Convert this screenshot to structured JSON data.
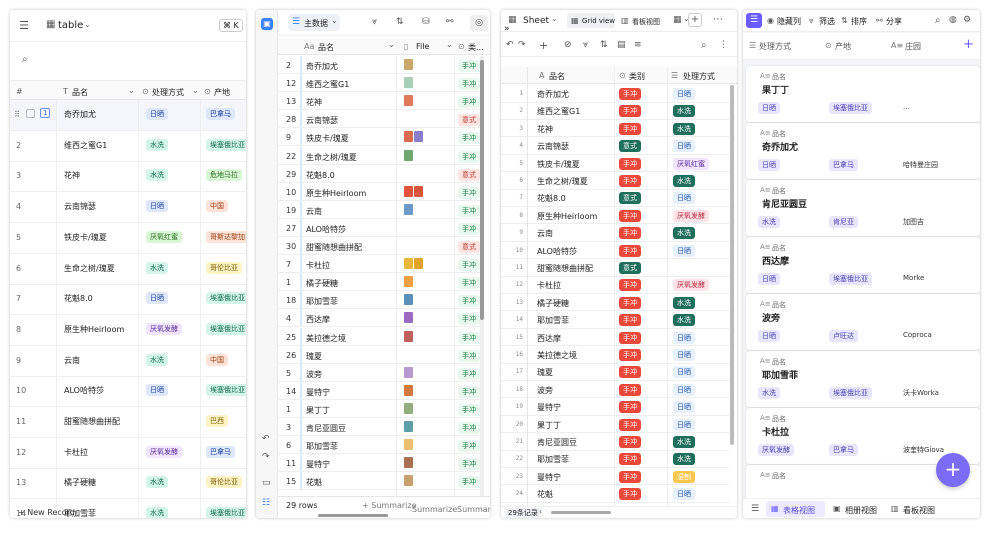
{
  "p1": {
    "title": "table",
    "shortcut": "⌘ K",
    "col_num": "#",
    "col_name": "品名",
    "col_proc": "处理方式",
    "col_origin": "产地",
    "new_record": "New Record",
    "rows": [
      {
        "n": "1",
        "name": "奇乔加尤",
        "proc": "日晒",
        "pc": "t-sun",
        "origin": "巴拿马",
        "oc": "t-sun"
      },
      {
        "n": "2",
        "name": "维西之蜜G1",
        "proc": "水洗",
        "pc": "t-wash",
        "origin": "埃塞俄比亚",
        "oc": "t-wash"
      },
      {
        "n": "3",
        "name": "花神",
        "proc": "水洗",
        "pc": "t-wash",
        "origin": "危地马拉",
        "oc": "t-anaer"
      },
      {
        "n": "4",
        "name": "云南锦瑟",
        "proc": "日晒",
        "pc": "t-sun",
        "origin": "中国",
        "oc": "t-honey"
      },
      {
        "n": "5",
        "name": "铁皮卡/瑰夏",
        "proc": "厌氧红蜜",
        "pc": "t-anaer",
        "origin": "哥斯达黎加",
        "oc": "t-honey"
      },
      {
        "n": "6",
        "name": "生命之树/瑰夏",
        "proc": "水洗",
        "pc": "t-wash",
        "origin": "哥伦比亚",
        "oc": "t-brazil"
      },
      {
        "n": "7",
        "name": "花魁8.0",
        "proc": "日晒",
        "pc": "t-sun",
        "origin": "埃塞俄比亚",
        "oc": "t-wash"
      },
      {
        "n": "8",
        "name": "原生种Heirloom",
        "proc": "厌氧发酵",
        "pc": "t-mix",
        "origin": "埃塞俄比亚",
        "oc": "t-wash"
      },
      {
        "n": "9",
        "name": "云南",
        "proc": "水洗",
        "pc": "t-wash",
        "origin": "中国",
        "oc": "t-honey"
      },
      {
        "n": "10",
        "name": "ALO哈特莎",
        "proc": "日晒",
        "pc": "t-sun",
        "origin": "埃塞俄比亚",
        "oc": "t-wash"
      },
      {
        "n": "11",
        "name": "甜蜜随想曲拼配",
        "proc": "",
        "pc": "",
        "origin": "巴西",
        "oc": "t-brazil"
      },
      {
        "n": "12",
        "name": "卡杜拉",
        "proc": "厌氧发酵",
        "pc": "t-mix",
        "origin": "巴拿马",
        "oc": "t-sun"
      },
      {
        "n": "13",
        "name": "橘子硬糖",
        "proc": "水洗",
        "pc": "t-wash",
        "origin": "哥伦比亚",
        "oc": "t-brazil"
      },
      {
        "n": "14",
        "name": "耶加雪菲",
        "proc": "水洗",
        "pc": "t-wash",
        "origin": "埃塞俄比亚",
        "oc": "t-wash"
      }
    ]
  },
  "p2": {
    "view": "主数据",
    "col_name": "品名",
    "col_file": "File",
    "col_type": "类...",
    "footer_rows": "29 rows",
    "summarize": "Summarize",
    "summarize2": "Summarize",
    "summarize3": "Summariz",
    "rows": [
      {
        "id": "2",
        "name": "奇乔加尤",
        "g": "手冲",
        "gc": "g-hand",
        "th": [
          "#c9a86a"
        ]
      },
      {
        "id": "12",
        "name": "维西之蜜G1",
        "g": "手冲",
        "gc": "g-hand",
        "th": [
          "#a8d0b8"
        ]
      },
      {
        "id": "13",
        "name": "花神",
        "g": "手冲",
        "gc": "g-hand",
        "th": [
          "#e07a5a"
        ]
      },
      {
        "id": "28",
        "name": "云南锦瑟",
        "g": "意式",
        "gc": "g-ice",
        "th": []
      },
      {
        "id": "9",
        "name": "铁皮卡/瑰夏",
        "g": "手冲",
        "gc": "g-hand",
        "th": [
          "#d96b4f",
          "#8a7dc9"
        ]
      },
      {
        "id": "22",
        "name": "生命之树/瑰夏",
        "g": "手冲",
        "gc": "g-hand",
        "th": [
          "#6ea86e"
        ]
      },
      {
        "id": "29",
        "name": "花魁8.0",
        "g": "意式",
        "gc": "g-ice",
        "th": []
      },
      {
        "id": "10",
        "name": "原生种Heirloom",
        "g": "手冲",
        "gc": "g-hand",
        "th": [
          "#e2543e",
          "#d8553a"
        ]
      },
      {
        "id": "19",
        "name": "云南",
        "g": "手冲",
        "gc": "g-hand",
        "th": [
          "#6b9ac8"
        ]
      },
      {
        "id": "27",
        "name": "ALO哈特莎",
        "g": "手冲",
        "gc": "g-hand",
        "th": []
      },
      {
        "id": "30",
        "name": "甜蜜随想曲拼配",
        "g": "意式",
        "gc": "g-ice",
        "th": []
      },
      {
        "id": "7",
        "name": "卡杜拉",
        "g": "手冲",
        "gc": "g-hand",
        "th": [
          "#e8b73c",
          "#e0a52a"
        ]
      },
      {
        "id": "1",
        "name": "橘子硬糖",
        "g": "手冲",
        "gc": "g-hand",
        "th": [
          "#f0a040"
        ]
      },
      {
        "id": "18",
        "name": "耶加雪菲",
        "g": "手冲",
        "gc": "g-hand",
        "th": [
          "#5a8fb8"
        ]
      },
      {
        "id": "4",
        "name": "西达摩",
        "g": "手冲",
        "gc": "g-hand",
        "th": [
          "#9c6ac0"
        ]
      },
      {
        "id": "25",
        "name": "美拉德之境",
        "g": "手冲",
        "gc": "g-hand",
        "th": [
          "#c0605a"
        ]
      },
      {
        "id": "26",
        "name": "瑰夏",
        "g": "手冲",
        "gc": "g-hand",
        "th": []
      },
      {
        "id": "5",
        "name": "波旁",
        "g": "手冲",
        "gc": "g-hand",
        "th": [
          "#b89ad0"
        ]
      },
      {
        "id": "14",
        "name": "曼特宁",
        "g": "手冲",
        "gc": "g-hand",
        "th": [
          "#d07a40"
        ]
      },
      {
        "id": "1",
        "name": "果丁丁",
        "g": "手冲",
        "gc": "g-hand",
        "th": [
          "#8fb07a"
        ]
      },
      {
        "id": "3",
        "name": "肯尼亚圆豆",
        "g": "手冲",
        "gc": "g-hand",
        "th": [
          "#5fa0a8"
        ]
      },
      {
        "id": "6",
        "name": "耶加雪菲",
        "g": "手冲",
        "gc": "g-hand",
        "th": [
          "#e8c070"
        ]
      },
      {
        "id": "11",
        "name": "曼特宁",
        "g": "手冲",
        "gc": "g-hand",
        "th": [
          "#a87050"
        ]
      },
      {
        "id": "15",
        "name": "花魁",
        "g": "手冲",
        "gc": "g-hand",
        "th": [
          "#c8a070"
        ]
      }
    ]
  },
  "p3": {
    "sheet": "Sheet",
    "grid": "Grid view",
    "kanban": "看板视图",
    "col_name": "品名",
    "col_cat": "类别",
    "col_proc": "处理方式",
    "footer": "29条记录",
    "rows": [
      {
        "n": "1",
        "name": "奇乔加尤",
        "c": "手冲",
        "cc": "d-hand",
        "p": "日晒",
        "pc": "d-s"
      },
      {
        "n": "2",
        "name": "维西之蜜G1",
        "c": "手冲",
        "cc": "d-hand",
        "p": "水洗",
        "pc": "d-w"
      },
      {
        "n": "3",
        "name": "花神",
        "c": "手冲",
        "cc": "d-hand",
        "p": "水洗",
        "pc": "d-w"
      },
      {
        "n": "4",
        "name": "云南锦瑟",
        "c": "意式",
        "cc": "d-ice",
        "p": "日晒",
        "pc": "d-s"
      },
      {
        "n": "5",
        "name": "铁皮卡/瑰夏",
        "c": "手冲",
        "cc": "d-hand",
        "p": "厌氧红蜜",
        "pc": "t-mix"
      },
      {
        "n": "6",
        "name": "生命之树/瑰夏",
        "c": "手冲",
        "cc": "d-hand",
        "p": "水洗",
        "pc": "d-w"
      },
      {
        "n": "7",
        "name": "花魁8.0",
        "c": "意式",
        "cc": "d-ice",
        "p": "日晒",
        "pc": "d-s"
      },
      {
        "n": "8",
        "name": "原生种Heirloom",
        "c": "手冲",
        "cc": "d-hand",
        "p": "厌氧发酵",
        "pc": "d-ab"
      },
      {
        "n": "9",
        "name": "云南",
        "c": "手冲",
        "cc": "d-hand",
        "p": "水洗",
        "pc": "d-w"
      },
      {
        "n": "10",
        "name": "ALO哈特莎",
        "c": "手冲",
        "cc": "d-hand",
        "p": "日晒",
        "pc": "d-s"
      },
      {
        "n": "11",
        "name": "甜蜜随想曲拼配",
        "c": "意式",
        "cc": "d-ice",
        "p": "",
        "pc": ""
      },
      {
        "n": "12",
        "name": "卡杜拉",
        "c": "手冲",
        "cc": "d-hand",
        "p": "厌氧发酵",
        "pc": "d-ab"
      },
      {
        "n": "13",
        "name": "橘子硬糖",
        "c": "手冲",
        "cc": "d-hand",
        "p": "水洗",
        "pc": "d-w"
      },
      {
        "n": "14",
        "name": "耶加雪菲",
        "c": "手冲",
        "cc": "d-hand",
        "p": "水洗",
        "pc": "d-w"
      },
      {
        "n": "15",
        "name": "西达摩",
        "c": "手冲",
        "cc": "d-hand",
        "p": "日晒",
        "pc": "d-s"
      },
      {
        "n": "16",
        "name": "美拉德之境",
        "c": "手冲",
        "cc": "d-hand",
        "p": "日晒",
        "pc": "d-s"
      },
      {
        "n": "17",
        "name": "瑰夏",
        "c": "手冲",
        "cc": "d-hand",
        "p": "日晒",
        "pc": "d-s"
      },
      {
        "n": "18",
        "name": "波旁",
        "c": "手冲",
        "cc": "d-hand",
        "p": "日晒",
        "pc": "d-s"
      },
      {
        "n": "19",
        "name": "曼特宁",
        "c": "手冲",
        "cc": "d-hand",
        "p": "日晒",
        "pc": "d-s"
      },
      {
        "n": "20",
        "name": "果丁丁",
        "c": "手冲",
        "cc": "d-hand",
        "p": "日晒",
        "pc": "d-s"
      },
      {
        "n": "21",
        "name": "肯尼亚圆豆",
        "c": "手冲",
        "cc": "d-hand",
        "p": "水洗",
        "pc": "d-w"
      },
      {
        "n": "22",
        "name": "耶加雪菲",
        "c": "手冲",
        "cc": "d-hand",
        "p": "水洗",
        "pc": "d-w"
      },
      {
        "n": "23",
        "name": "曼特宁",
        "c": "手冲",
        "cc": "d-hand",
        "p": "湿刨",
        "pc": "d-x"
      },
      {
        "n": "24",
        "name": "花魁",
        "c": "手冲",
        "cc": "d-hand",
        "p": "日晒",
        "pc": "d-s"
      }
    ]
  },
  "p4": {
    "hide": "隐藏列",
    "filter": "筛选",
    "sort": "排序",
    "share": "分享",
    "col_proc": "处理方式",
    "col_origin": "产地",
    "col_farm": "庄园",
    "field_label": "品名",
    "tab_grid": "表格视图",
    "tab_album": "相册视图",
    "tab_kanban": "看板视图",
    "cards": [
      {
        "name": "果丁丁",
        "proc": "日晒",
        "origin": "埃塞俄比亚",
        "farm": "..."
      },
      {
        "name": "奇乔加尤",
        "proc": "日晒",
        "origin": "巴拿马",
        "farm": "哈特曼庄园"
      },
      {
        "name": "肯尼亚圆豆",
        "proc": "水洗",
        "origin": "肯尼亚",
        "farm": "加图吉"
      },
      {
        "name": "西达摩",
        "proc": "日晒",
        "origin": "埃塞俄比亚",
        "farm": "Morke"
      },
      {
        "name": "波旁",
        "proc": "日晒",
        "origin": "卢旺达",
        "farm": "Coproca"
      },
      {
        "name": "耶加雪菲",
        "proc": "水洗",
        "origin": "埃塞俄比亚",
        "farm": "沃卡Worka"
      },
      {
        "name": "卡杜拉",
        "proc": "厌氧发酵",
        "origin": "巴拿马",
        "farm": "波奎特Giova"
      },
      {
        "name": "",
        "proc": "",
        "origin": "",
        "farm": ""
      }
    ]
  }
}
